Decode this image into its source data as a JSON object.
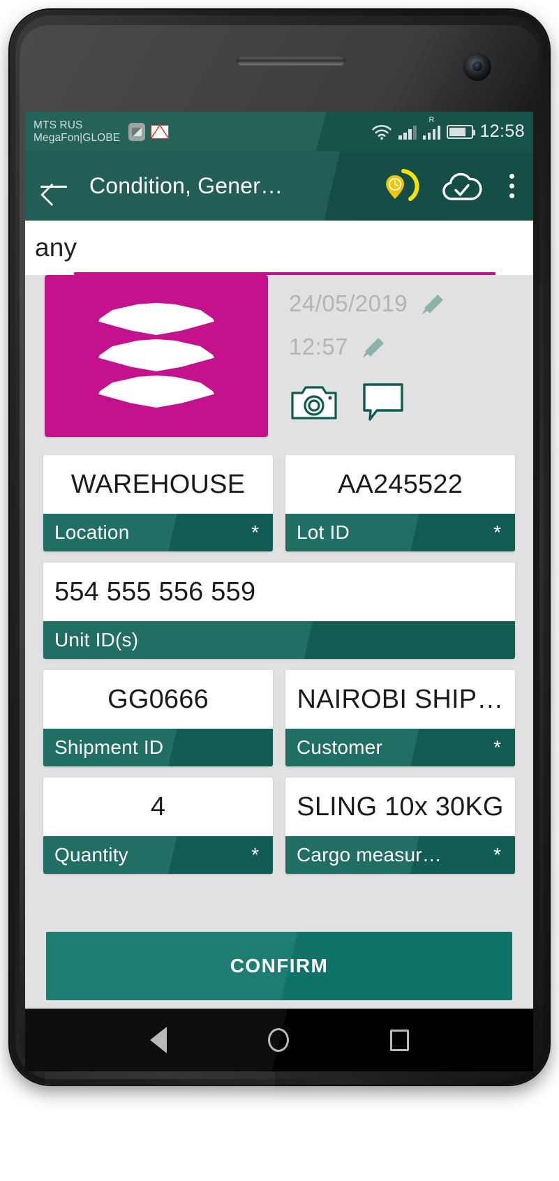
{
  "status_bar": {
    "carrier_line1": "MTS RUS",
    "carrier_line2": "MegaFon|GLOBE",
    "icons": [
      "screenshot-image-icon",
      "gmail-icon",
      "wifi-icon",
      "signal-icon",
      "signal-roaming-icon",
      "battery-icon"
    ],
    "roaming_indicator": "R",
    "time": "12:58"
  },
  "app_bar": {
    "back_label": "back-arrow",
    "title": "Condition, Gener…",
    "actions": [
      "gps-clock-pin-icon",
      "cloud-check-icon",
      "overflow-menu-icon"
    ]
  },
  "search": {
    "value": "any",
    "placeholder": "any"
  },
  "record_header": {
    "logo_alt": "stacked-cargo-logo",
    "date": "24/05/2019",
    "time": "12:57",
    "date_edit_icon": "pencil-icon",
    "time_edit_icon": "pencil-icon",
    "camera_icon": "camera-icon",
    "comment_icon": "comment-icon"
  },
  "fields": [
    [
      {
        "value": "WAREHOUSE",
        "label": "Location",
        "required": "*",
        "align": "center"
      },
      {
        "value": "AA245522",
        "label": "Lot ID",
        "required": "*",
        "align": "center"
      }
    ],
    [
      {
        "value": "554 555 556 559",
        "label": "Unit ID(s)",
        "required": "",
        "align": "left",
        "full": true
      }
    ],
    [
      {
        "value": "GG0666",
        "label": "Shipment ID",
        "required": "",
        "align": "center"
      },
      {
        "value": "NAIROBI SHIP…",
        "label": "Customer",
        "required": "*",
        "align": "center"
      }
    ],
    [
      {
        "value": "4",
        "label": "Quantity",
        "required": "*",
        "align": "center"
      },
      {
        "value": "SLING 10x 30KG",
        "label": "Cargo measur…",
        "required": "*",
        "align": "center"
      }
    ]
  ],
  "confirm": {
    "label": "CONFIRM"
  },
  "nav_bar": {
    "back": "nav-back-icon",
    "home": "nav-home-icon",
    "recents": "nav-recents-icon"
  },
  "colors": {
    "app_bar_teal": "#16554c",
    "status_bar_teal": "#1b5c52",
    "label_teal": "#14665c",
    "confirm_teal": "#11776c",
    "accent_magenta": "#C4128C",
    "screen_bg": "#E1E1E1",
    "gps_yellow": "#F5D400"
  }
}
